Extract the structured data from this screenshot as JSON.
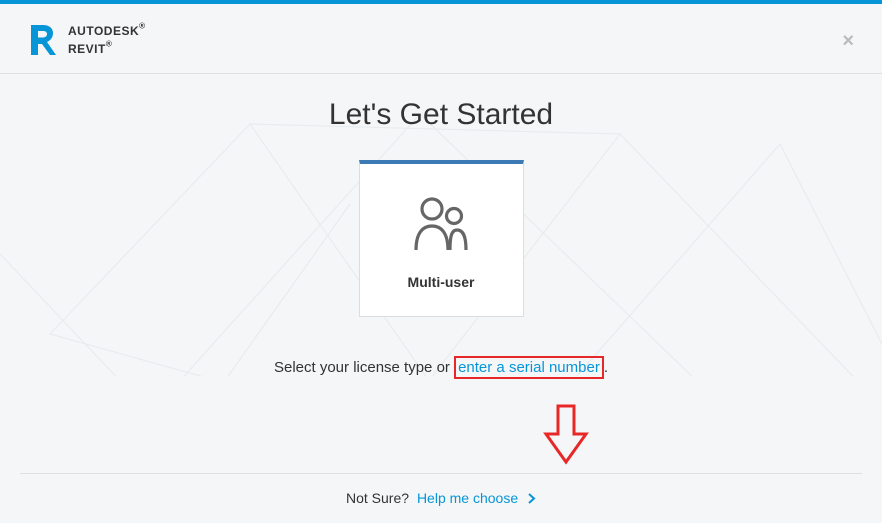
{
  "header": {
    "company": "AUTODESK",
    "product": "REVIT"
  },
  "main": {
    "title": "Let's Get Started",
    "card": {
      "label": "Multi-user"
    },
    "instruction_prefix": "Select your license type or ",
    "serial_link": "enter a serial number",
    "instruction_suffix": "."
  },
  "footer": {
    "prompt": "Not Sure?",
    "help_link": "Help me choose"
  }
}
